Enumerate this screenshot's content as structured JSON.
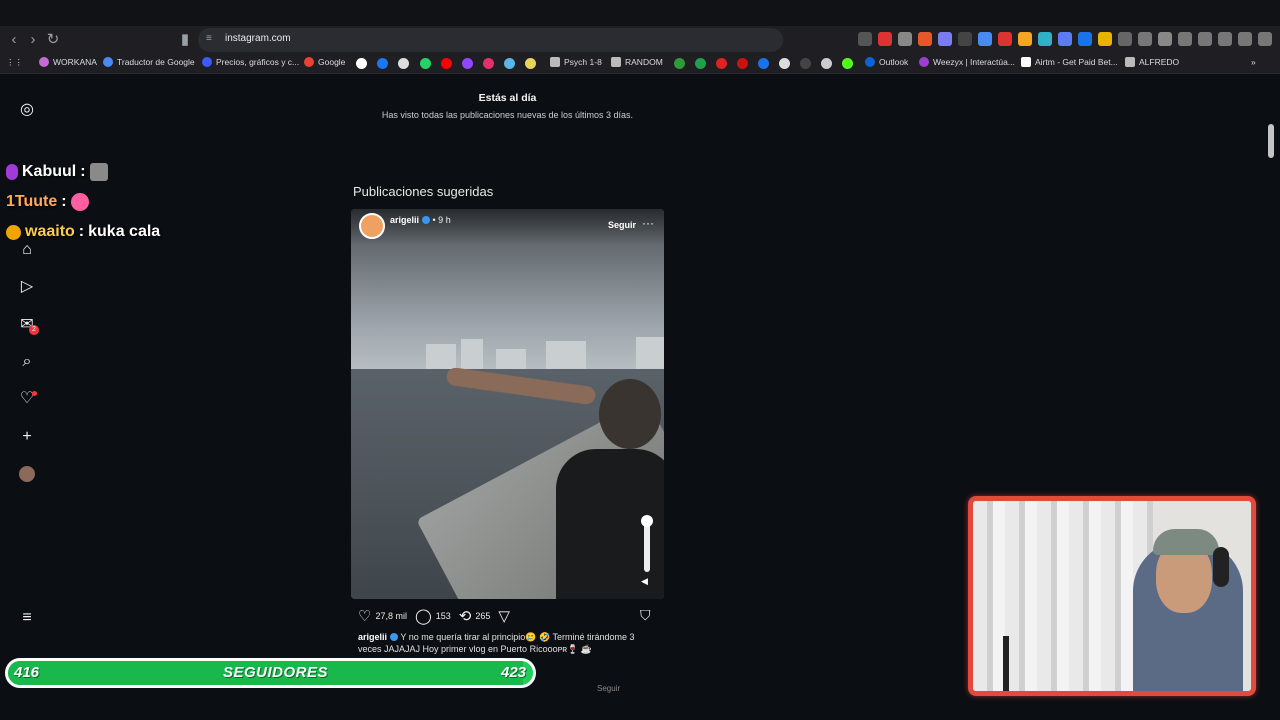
{
  "browser": {
    "url": "instagram.com",
    "bookmarks": [
      {
        "label": "WORKANA",
        "color": "#c46bd8"
      },
      {
        "label": "Traductor de Google",
        "color": "#4a8af4"
      },
      {
        "label": "Precios, gráficos y c...",
        "color": "#3d5afe"
      },
      {
        "label": "Google",
        "color": "#ea4335"
      },
      {
        "label": "Psych 1-8",
        "color": "#bbbbbb"
      },
      {
        "label": "RANDOM",
        "color": "#bbbbbb"
      },
      {
        "label": "Outlook",
        "color": "#0a64d6"
      },
      {
        "label": "Weezyx | Interactúa...",
        "color": "#9b3fd1"
      },
      {
        "label": "Airtm - Get Paid Bet...",
        "color": "#ffffff"
      },
      {
        "label": "ALFREDO",
        "color": "#bbbbbb"
      }
    ]
  },
  "feed": {
    "uptodate_title": "Estás al día",
    "uptodate_sub": "Has visto todas las publicaciones nuevas de los últimos 3 días.",
    "suggested_title": "Publicaciones sugeridas",
    "post": {
      "username": "arigelii",
      "time": "• 9 h",
      "follow": "Seguir",
      "more": "···",
      "likes": "27,8 mil",
      "comments": "153",
      "reposts": "265",
      "caption_user": "arigelii",
      "caption": " Y no me quería tirar al principio🥲 🤣 Terminé tirándome 3 veces JAJAJAJ Hoy primer vlog en Puerto Ricoooᴘʀ🍷 ☕"
    },
    "next_follow": "Seguir",
    "notif_badge": "2"
  },
  "overlay": {
    "chat": [
      {
        "name": "Kabuul",
        "sep": ":",
        "msg": "",
        "icon_color": "#a23ad8"
      },
      {
        "name": "1Tuute",
        "sep": ":",
        "msg": "",
        "icon_color": ""
      },
      {
        "name": "waaito",
        "sep": ":",
        "msg": "kuka cala",
        "icon_color": "#f0a500"
      }
    ],
    "followers": {
      "current": "416",
      "label": "SEGUIDORES",
      "goal": "423",
      "progress": 0.98
    }
  }
}
